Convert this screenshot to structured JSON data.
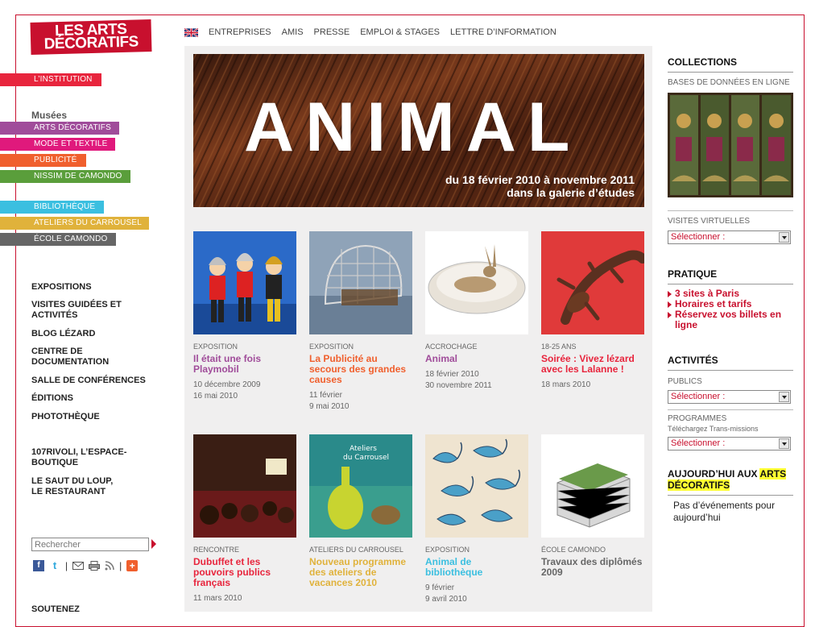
{
  "logo": {
    "line1": "LES ARTS",
    "line2": "DÉCORATIFS"
  },
  "left_nav": {
    "institution": "L’INSTITUTION",
    "musees_title": "Musées",
    "musees": [
      "ARTS DÉCORATIFS",
      "MODE ET TEXTILE",
      "PUBLICITÉ",
      "NISSIM DE CAMONDO"
    ],
    "other": [
      "BIBLIOTHÈQUE",
      "ATELIERS DU CARROUSEL",
      "ÉCOLE CAMONDO"
    ],
    "colors": {
      "institution": "#e8253d",
      "arts": "#a04c9a",
      "mode": "#e0197c",
      "pub": "#f05f2d",
      "nissim": "#5a9e3b",
      "biblio": "#3bbfe0",
      "ateliers": "#e0b23b",
      "ecole": "#666666"
    },
    "links": [
      "EXPOSITIONS",
      "VISITES GUIDÉES ET ACTIVITÉS",
      "BLOG LÉZARD",
      "CENTRE DE DOCUMENTATION",
      "SALLE DE CONFÉRENCES",
      "ÉDITIONS",
      "PHOTOTHÈQUE",
      "107RIVOLI, L’ESPACE-BOUTIQUE",
      "LE SAUT DU LOUP, LE RESTAURANT"
    ],
    "search_placeholder": "Rechercher",
    "soutenez": "SOUTENEZ"
  },
  "top_nav": [
    "ENTREPRISES",
    "AMIS",
    "PRESSE",
    "EMPLOI & STAGES",
    "LETTRE D’INFORMATION"
  ],
  "hero": {
    "title": "ANIMAL",
    "subtitle_line1": "du 18 février 2010 à novembre 2011",
    "subtitle_line2": "dans la galerie d’études"
  },
  "cards": [
    {
      "cat": "EXPOSITION",
      "title": "Il était une fois Playmobil",
      "date1": "10 décembre 2009",
      "date2": "16 mai 2010",
      "color": "#a04c9a"
    },
    {
      "cat": "EXPOSITION",
      "title": "La Publicité au secours des grandes causes",
      "date1": "11 février",
      "date2": "9 mai 2010",
      "color": "#f05f2d"
    },
    {
      "cat": "ACCROCHAGE",
      "title": "Animal",
      "date1": "18 février 2010",
      "date2": "30 novembre 2011",
      "color": "#a04c9a"
    },
    {
      "cat": "18-25 ANS",
      "title": "Soirée : Vivez lézard avec les Lalanne !",
      "date1": "18 mars 2010",
      "date2": "",
      "color": "#e8253d"
    },
    {
      "cat": "RENCONTRE",
      "title": "Dubuffet et les pouvoirs publics français",
      "date1": "11 mars 2010",
      "date2": "",
      "color": "#e8253d"
    },
    {
      "cat": "ATELIERS DU CARROUSEL",
      "title": "Nouveau programme des ateliers de vacances 2010",
      "date1": "",
      "date2": "",
      "color": "#e0b23b"
    },
    {
      "cat": "EXPOSITION",
      "title": "Animal de bibliothèque",
      "date1": "9 février",
      "date2": "9 avril 2010",
      "color": "#3bbfe0"
    },
    {
      "cat": "ÉCOLE CAMONDO",
      "title": "Travaux des diplômés 2009",
      "date1": "",
      "date2": "",
      "color": "#666666"
    }
  ],
  "right": {
    "collections": "COLLECTIONS",
    "bases": "BASES DE DONNÉES EN LIGNE",
    "visites": "VISITES VIRTUELLES",
    "select_label": "Sélectionner :",
    "pratique": "PRATIQUE",
    "pratique_links": [
      "3 sites à Paris",
      "Horaires et tarifs",
      "Réservez vos billets en ligne"
    ],
    "activites": "ACTIVITÉS",
    "publics": "PUBLICS",
    "programmes": "PROGRAMMES",
    "telechargez": "Téléchargez Trans-missions",
    "aujourdhui_prefix": "AUJOURD’HUI AUX ",
    "aujourdhui_hl": "ARTS DÉCORATIFS",
    "no_events": "Pas d’événements pour aujourd’hui"
  }
}
